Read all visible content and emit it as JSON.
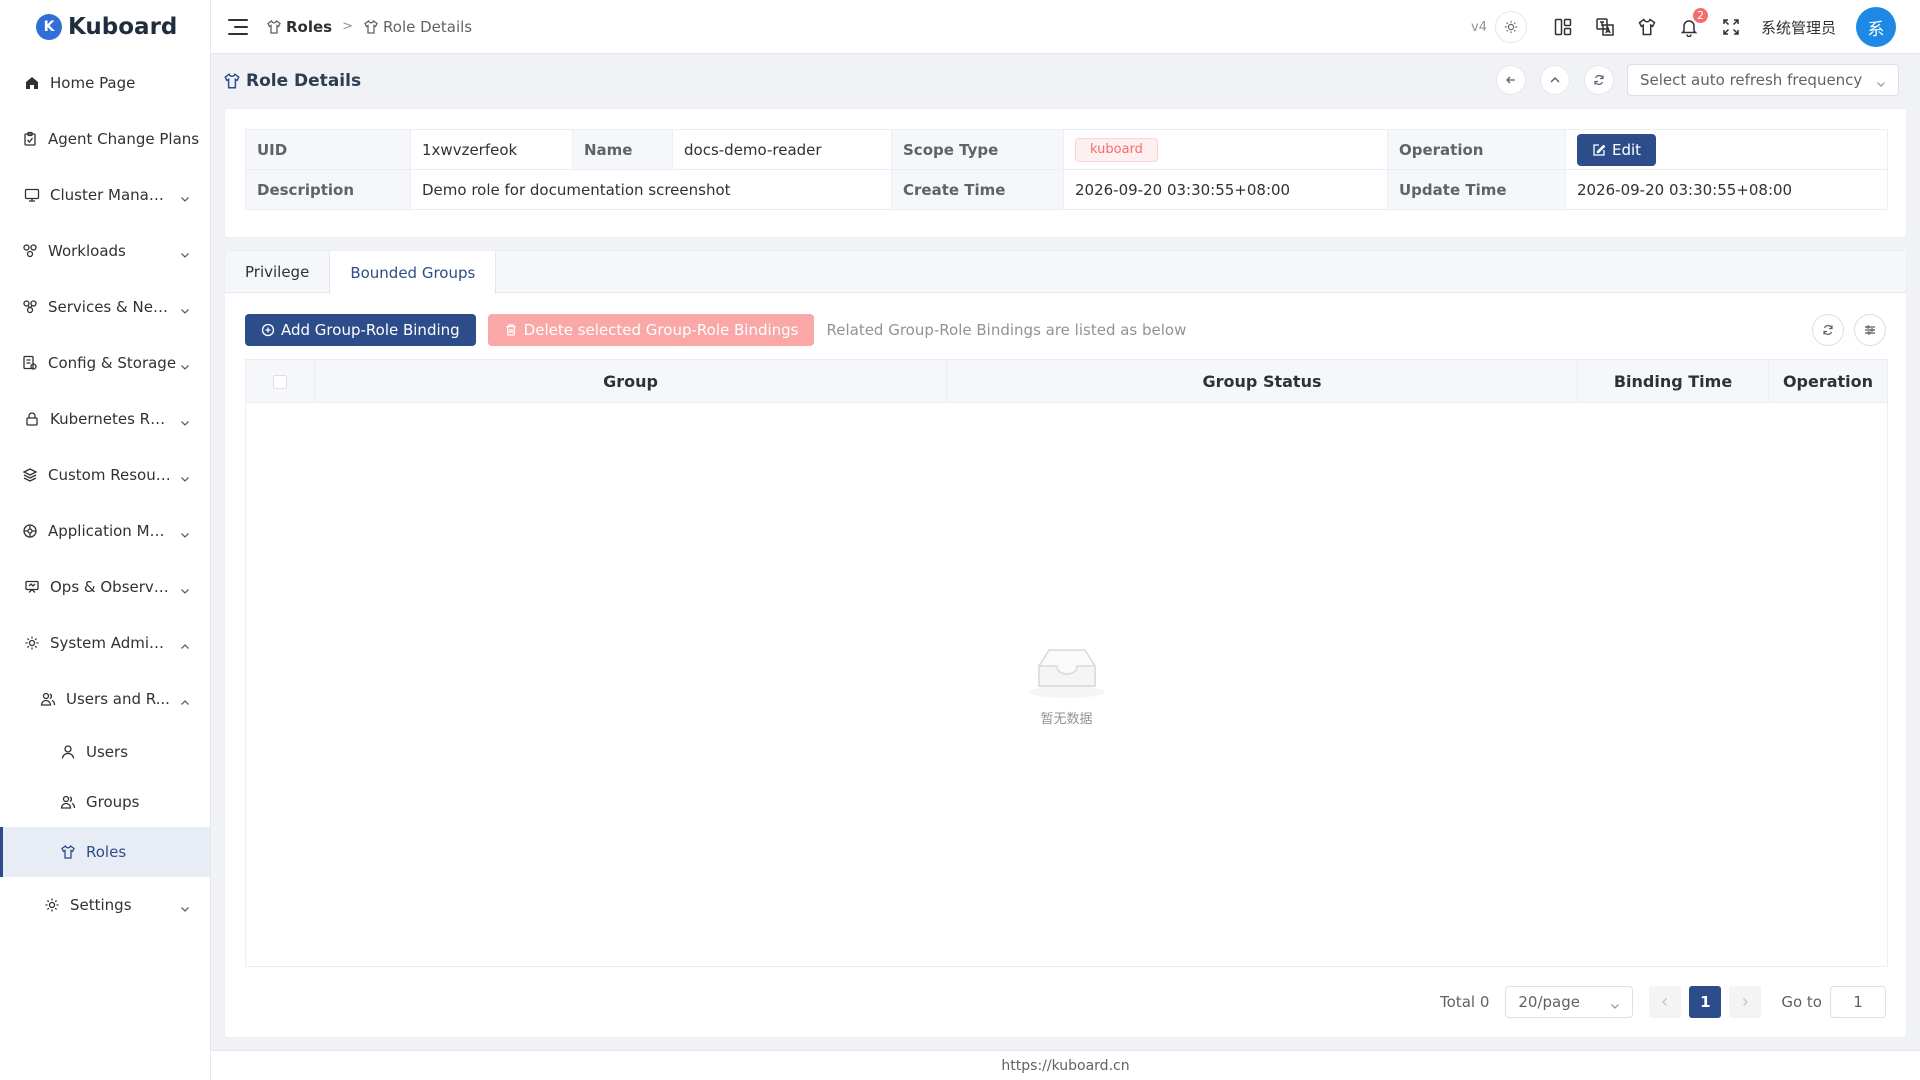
{
  "app": {
    "name": "Kuboard",
    "logo_letter": "K"
  },
  "sidebar": {
    "items": [
      {
        "label": "Home Page",
        "icon": "home-icon"
      },
      {
        "label": "Agent Change Plans",
        "icon": "clipboard-icon"
      },
      {
        "label": "Cluster Manag...",
        "icon": "monitor-icon"
      },
      {
        "label": "Workloads",
        "icon": "cluster-icon"
      },
      {
        "label": "Services & Net...",
        "icon": "network-icon"
      },
      {
        "label": "Config & Storage",
        "icon": "config-icon"
      },
      {
        "label": "Kubernetes RB...",
        "icon": "lock-icon"
      },
      {
        "label": "Custom Resour...",
        "icon": "layers-icon"
      },
      {
        "label": "Application Ma...",
        "icon": "app-icon"
      },
      {
        "label": "Ops & Observa...",
        "icon": "observe-icon"
      },
      {
        "label": "System Admini...",
        "icon": "gear-icon"
      },
      {
        "label": "Users and R...",
        "icon": "users-icon"
      },
      {
        "label": "Users",
        "icon": "user-icon"
      },
      {
        "label": "Groups",
        "icon": "group-icon"
      },
      {
        "label": "Roles",
        "icon": "shirt-icon"
      },
      {
        "label": "Settings",
        "icon": "settings-icon"
      }
    ]
  },
  "header": {
    "breadcrumb": [
      "Roles",
      "Role Details"
    ],
    "version": "v4",
    "notification_count": "2",
    "username": "系统管理员",
    "avatar_text": "系"
  },
  "page": {
    "title": "Role Details",
    "refresh_placeholder": "Select auto refresh frequency"
  },
  "info": {
    "uid_label": "UID",
    "uid": "1xwvzerfeok",
    "name_label": "Name",
    "name": "docs-demo-reader",
    "scope_label": "Scope Type",
    "scope": "kuboard",
    "operation_label": "Operation",
    "edit_label": "Edit",
    "desc_label": "Description",
    "desc": "Demo role for documentation screenshot",
    "create_label": "Create Time",
    "create": "2026-09-20 03:30:55+08:00",
    "update_label": "Update Time",
    "update": "2026-09-20 03:30:55+08:00"
  },
  "tabs": [
    {
      "label": "Privilege"
    },
    {
      "label": "Bounded Groups"
    }
  ],
  "toolbar": {
    "add_label": "Add Group-Role Binding",
    "delete_label": "Delete selected Group-Role Bindings",
    "hint": "Related Group-Role Bindings are listed as below"
  },
  "table": {
    "columns": [
      "Group",
      "Group Status",
      "Binding Time",
      "Operation"
    ],
    "empty_text": "暂无数据"
  },
  "pagination": {
    "total": "Total 0",
    "page_size": "20/page",
    "current_page": "1",
    "goto_label": "Go to",
    "goto_value": "1"
  },
  "footer": {
    "url": "https://kuboard.cn"
  }
}
